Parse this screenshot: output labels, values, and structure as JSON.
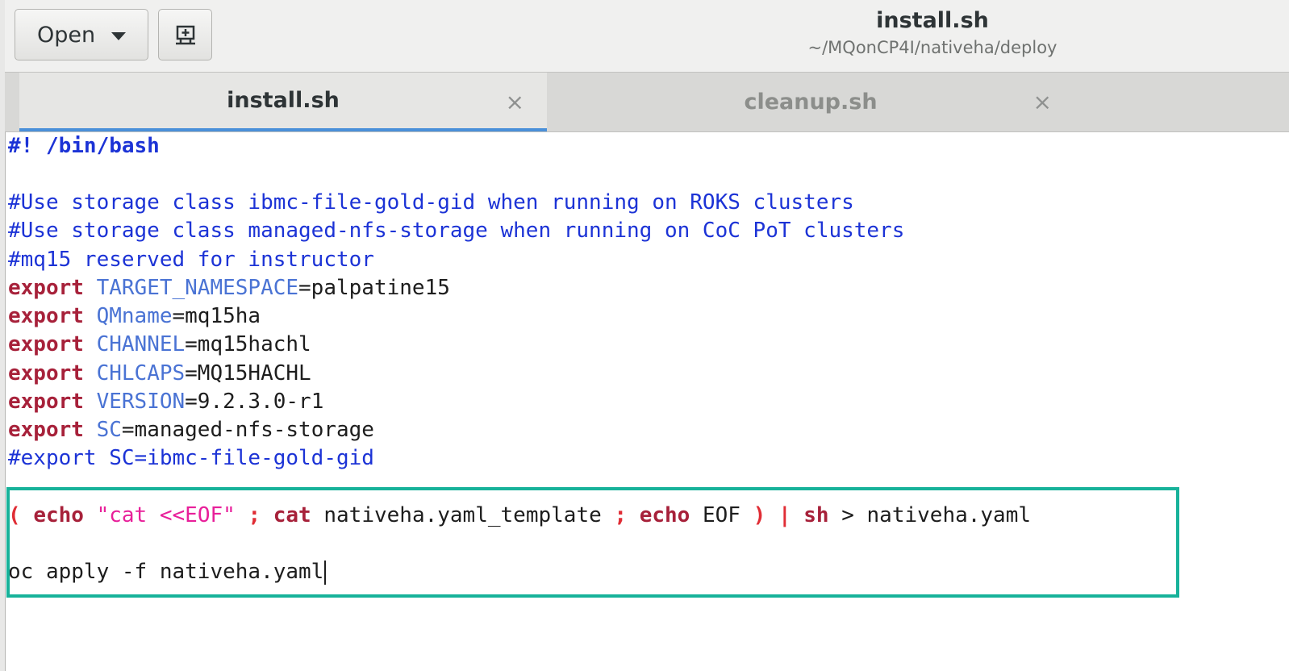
{
  "header": {
    "open_label": "Open",
    "title": "install.sh",
    "subtitle": "~/MQonCP4I/nativeha/deploy"
  },
  "tabs": [
    {
      "label": "install.sh",
      "close": "×"
    },
    {
      "label": "cleanup.sh",
      "close": "×"
    }
  ],
  "code": {
    "shebang": "#! /bin/bash",
    "comment1": "#Use storage class ibmc-file-gold-gid when running on ROKS clusters",
    "comment2": "#Use storage class managed-nfs-storage when running on CoC PoT clusters",
    "comment3": "#mq15 reserved for instructor",
    "export_kw": "export",
    "exports": [
      {
        "var": "TARGET_NAMESPACE",
        "value": "=palpatine15"
      },
      {
        "var": "QMname",
        "value": "=mq15ha"
      },
      {
        "var": "CHANNEL",
        "value": "=mq15hachl"
      },
      {
        "var": "CHLCAPS",
        "value": "=MQ15HACHL"
      },
      {
        "var": "VERSION",
        "value": "=9.2.3.0-r1"
      },
      {
        "var": "SC",
        "value": "=managed-nfs-storage"
      }
    ],
    "comment4": "#export SC=ibmc-file-gold-gid",
    "pipeline": {
      "open_paren": "(",
      "echo1": "echo",
      "str": "\"cat <<EOF\"",
      "semi1": ";",
      "cat": "cat",
      "file": "nativeha.yaml_template",
      "semi2": ";",
      "echo2": "echo",
      "eof": "EOF",
      "close_paren": ")",
      "pipe": "|",
      "sh": "sh",
      "redirect": "> nativeha.yaml"
    },
    "apply": "oc apply -f nativeha.yaml"
  }
}
